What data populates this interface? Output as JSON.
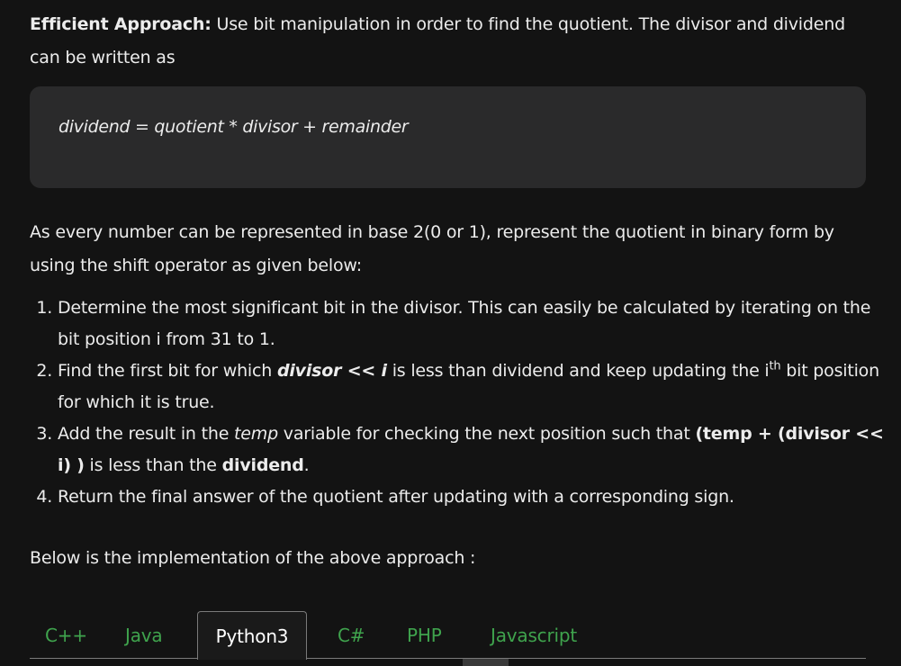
{
  "intro": {
    "heading": "Efficient Approach:",
    "text": " Use bit manipulation in order to find the quotient. The divisor and dividend can be written as"
  },
  "formula": "dividend = quotient * divisor + remainder",
  "para2": "As every number can be represented in base 2(0 or 1), represent the quotient in binary form by using the shift operator as given below:",
  "steps": {
    "s1": "Determine the most significant bit in the divisor. This can easily be calculated by iterating on the bit position i from 31 to 1.",
    "s2_a": "Find the first bit for which ",
    "s2_b": "divisor << i",
    "s2_c": " is less than dividend and keep updating the i",
    "s2_sup": "th",
    "s2_d": " bit position for which it is true.",
    "s3_a": "Add the result in the ",
    "s3_b": "temp",
    "s3_c": " variable for checking the next position such that ",
    "s3_d": "(temp + (divisor << i) )",
    "s3_e": " is less than the ",
    "s3_f": "dividend",
    "s3_g": ".",
    "s4": "Return the final answer of the quotient after updating with a corresponding sign."
  },
  "para3": "Below is the implementation of the above approach :",
  "tabs": [
    {
      "label": "C++"
    },
    {
      "label": "Java"
    },
    {
      "label": "Python3"
    },
    {
      "label": "C#"
    },
    {
      "label": "PHP"
    },
    {
      "label": "Javascript"
    }
  ],
  "colors": {
    "tab_inactive": "#3fa34d",
    "tab_active": "#ffffff",
    "background": "#131313",
    "formula_box": "#2a2a2b"
  }
}
